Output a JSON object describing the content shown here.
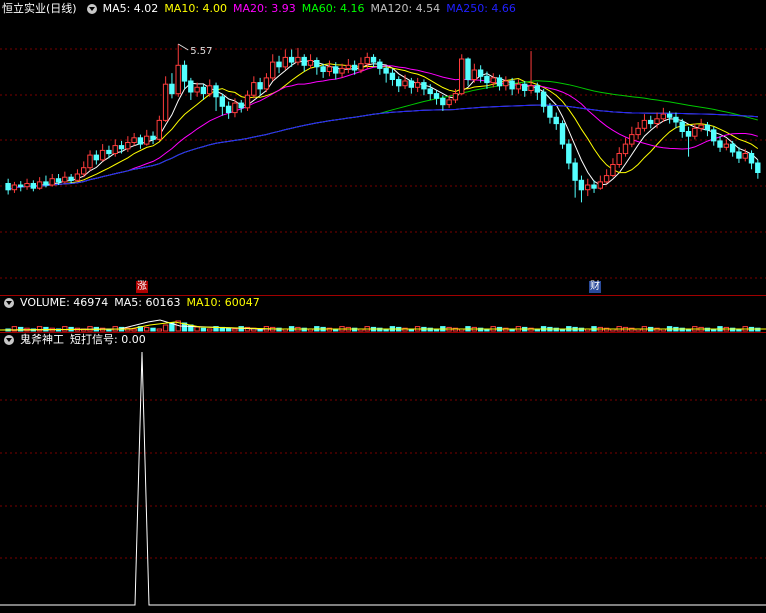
{
  "header": {
    "stock_name": "恒立实业(日线)",
    "ma": [
      {
        "label": "MA5: 4.02",
        "color": "#ffffff"
      },
      {
        "label": "MA10: 4.00",
        "color": "#ffff00"
      },
      {
        "label": "MA20: 3.93",
        "color": "#ff00ff"
      },
      {
        "label": "MA60: 4.16",
        "color": "#00ff00"
      },
      {
        "label": "MA120: 4.54",
        "color": "#c0c0c0"
      },
      {
        "label": "MA250: 4.66",
        "color": "#0000ff"
      }
    ]
  },
  "volume_header": {
    "volume": "VOLUME: 46974",
    "ma5": "MA5: 60163",
    "ma10": "MA10: 60047"
  },
  "indicator_header": {
    "name": "鬼斧神工",
    "signal": "短打信号: 0.00"
  },
  "markers": {
    "zhang": "涨",
    "cai": "财",
    "high_price": "5.57"
  },
  "colors": {
    "up": "#ff3c3c",
    "down": "#54ffff",
    "grid": "#7a0000",
    "ma5": "#ffffff",
    "ma10": "#ffff00",
    "ma20": "#ff00ff",
    "ma60": "#00c800",
    "ma120": "#c0c0c0",
    "ma250": "#2020ff"
  },
  "chart_data": [
    {
      "type": "candlestick",
      "title": "恒立实业(日线)",
      "ylim": [
        2.6,
        5.9
      ],
      "candles": [
        [
          3.8,
          3.72,
          3.86,
          3.66
        ],
        [
          3.72,
          3.78,
          3.82,
          3.68
        ],
        [
          3.78,
          3.76,
          3.83,
          3.7
        ],
        [
          3.76,
          3.8,
          3.86,
          3.72
        ],
        [
          3.8,
          3.74,
          3.84,
          3.7
        ],
        [
          3.74,
          3.82,
          3.88,
          3.72
        ],
        [
          3.82,
          3.78,
          3.9,
          3.75
        ],
        [
          3.78,
          3.86,
          3.92,
          3.76
        ],
        [
          3.86,
          3.82,
          3.92,
          3.78
        ],
        [
          3.82,
          3.88,
          3.95,
          3.8
        ],
        [
          3.88,
          3.84,
          3.92,
          3.8
        ],
        [
          3.84,
          3.92,
          3.98,
          3.82
        ],
        [
          3.92,
          4.0,
          4.08,
          3.88
        ],
        [
          4.0,
          4.16,
          4.22,
          3.96
        ],
        [
          4.16,
          4.1,
          4.22,
          4.04
        ],
        [
          4.1,
          4.22,
          4.3,
          4.08
        ],
        [
          4.22,
          4.18,
          4.28,
          4.12
        ],
        [
          4.18,
          4.28,
          4.36,
          4.14
        ],
        [
          4.28,
          4.24,
          4.34,
          4.18
        ],
        [
          4.24,
          4.32,
          4.4,
          4.2
        ],
        [
          4.32,
          4.38,
          4.44,
          4.28
        ],
        [
          4.38,
          4.3,
          4.42,
          4.24
        ],
        [
          4.3,
          4.4,
          4.48,
          4.28
        ],
        [
          4.4,
          4.36,
          4.46,
          4.3
        ],
        [
          4.36,
          4.6,
          4.66,
          4.34
        ],
        [
          4.6,
          5.06,
          5.16,
          4.58
        ],
        [
          5.06,
          4.94,
          5.2,
          4.88
        ],
        [
          4.94,
          5.3,
          5.57,
          4.9
        ],
        [
          5.3,
          5.1,
          5.36,
          5.0
        ],
        [
          5.1,
          4.96,
          5.14,
          4.86
        ],
        [
          4.96,
          5.02,
          5.08,
          4.9
        ],
        [
          5.02,
          4.94,
          5.06,
          4.86
        ],
        [
          4.94,
          5.04,
          5.12,
          4.9
        ],
        [
          5.04,
          4.9,
          5.08,
          4.72
        ],
        [
          4.9,
          4.78,
          4.94,
          4.66
        ],
        [
          4.78,
          4.7,
          4.84,
          4.62
        ],
        [
          4.7,
          4.82,
          4.88,
          4.64
        ],
        [
          4.82,
          4.76,
          4.86,
          4.7
        ],
        [
          4.76,
          4.92,
          4.98,
          4.72
        ],
        [
          4.92,
          5.08,
          5.16,
          4.88
        ],
        [
          5.08,
          5.0,
          5.14,
          4.92
        ],
        [
          5.0,
          5.14,
          5.2,
          4.96
        ],
        [
          5.14,
          5.34,
          5.44,
          5.1
        ],
        [
          5.34,
          5.28,
          5.42,
          5.2
        ],
        [
          5.28,
          5.4,
          5.5,
          5.24
        ],
        [
          5.4,
          5.34,
          5.5,
          5.28
        ],
        [
          5.34,
          5.4,
          5.52,
          5.3
        ],
        [
          5.4,
          5.3,
          5.44,
          5.22
        ],
        [
          5.3,
          5.36,
          5.44,
          5.26
        ],
        [
          5.36,
          5.28,
          5.4,
          5.18
        ],
        [
          5.28,
          5.22,
          5.32,
          5.14
        ],
        [
          5.22,
          5.28,
          5.36,
          5.16
        ],
        [
          5.28,
          5.2,
          5.34,
          5.12
        ],
        [
          5.2,
          5.26,
          5.32,
          5.14
        ],
        [
          5.26,
          5.3,
          5.38,
          5.2
        ],
        [
          5.3,
          5.24,
          5.36,
          5.18
        ],
        [
          5.24,
          5.32,
          5.4,
          5.2
        ],
        [
          5.32,
          5.4,
          5.46,
          5.26
        ],
        [
          5.4,
          5.34,
          5.44,
          5.28
        ],
        [
          5.34,
          5.26,
          5.38,
          5.18
        ],
        [
          5.26,
          5.2,
          5.3,
          5.08
        ],
        [
          5.2,
          5.12,
          5.26,
          5.04
        ],
        [
          5.12,
          5.04,
          5.16,
          4.96
        ],
        [
          5.04,
          5.1,
          5.18,
          5.0
        ],
        [
          5.1,
          5.02,
          5.14,
          4.94
        ],
        [
          5.02,
          5.08,
          5.14,
          4.96
        ],
        [
          5.08,
          5.0,
          5.12,
          4.92
        ],
        [
          5.0,
          4.94,
          5.06,
          4.86
        ],
        [
          4.94,
          4.88,
          4.98,
          4.8
        ],
        [
          4.88,
          4.8,
          4.92,
          4.72
        ],
        [
          4.8,
          4.86,
          4.92,
          4.76
        ],
        [
          4.86,
          4.94,
          5.0,
          4.82
        ],
        [
          4.94,
          5.38,
          5.44,
          4.92
        ],
        [
          5.38,
          5.12,
          5.4,
          5.04
        ],
        [
          5.12,
          5.24,
          5.32,
          5.08
        ],
        [
          5.24,
          5.16,
          5.3,
          5.08
        ],
        [
          5.16,
          5.08,
          5.22,
          5.0
        ],
        [
          5.08,
          5.14,
          5.2,
          5.02
        ],
        [
          5.14,
          5.04,
          5.18,
          4.98
        ],
        [
          5.04,
          5.1,
          5.16,
          4.98
        ],
        [
          5.1,
          5.0,
          5.14,
          4.92
        ],
        [
          5.0,
          5.06,
          5.12,
          4.94
        ],
        [
          5.06,
          4.98,
          5.1,
          4.9
        ],
        [
          4.98,
          5.04,
          5.48,
          4.94
        ],
        [
          5.04,
          4.96,
          5.08,
          4.86
        ],
        [
          4.96,
          4.78,
          5.0,
          4.7
        ],
        [
          4.78,
          4.64,
          4.82,
          4.56
        ],
        [
          4.64,
          4.56,
          4.7,
          4.48
        ],
        [
          4.56,
          4.3,
          4.6,
          4.24
        ],
        [
          4.3,
          4.06,
          4.36,
          3.98
        ],
        [
          4.06,
          3.84,
          4.12,
          3.62
        ],
        [
          3.84,
          3.72,
          3.9,
          3.56
        ],
        [
          3.72,
          3.78,
          3.86,
          3.64
        ],
        [
          3.78,
          3.74,
          3.84,
          3.68
        ],
        [
          3.74,
          3.82,
          3.9,
          3.72
        ],
        [
          3.82,
          3.9,
          3.98,
          3.8
        ],
        [
          3.9,
          4.04,
          4.12,
          3.88
        ],
        [
          4.04,
          4.18,
          4.26,
          4.0
        ],
        [
          4.18,
          4.3,
          4.38,
          4.14
        ],
        [
          4.3,
          4.42,
          4.52,
          4.26
        ],
        [
          4.42,
          4.5,
          4.58,
          4.36
        ],
        [
          4.5,
          4.6,
          4.68,
          4.46
        ],
        [
          4.6,
          4.56,
          4.66,
          4.5
        ],
        [
          4.56,
          4.62,
          4.7,
          4.5
        ],
        [
          4.62,
          4.68,
          4.76,
          4.58
        ],
        [
          4.68,
          4.64,
          4.72,
          4.56
        ],
        [
          4.64,
          4.58,
          4.7,
          4.5
        ],
        [
          4.58,
          4.46,
          4.62,
          4.38
        ],
        [
          4.46,
          4.4,
          4.52,
          4.14
        ],
        [
          4.4,
          4.5,
          4.56,
          4.36
        ],
        [
          4.5,
          4.54,
          4.62,
          4.46
        ],
        [
          4.54,
          4.48,
          4.58,
          4.4
        ],
        [
          4.48,
          4.34,
          4.52,
          4.28
        ],
        [
          4.34,
          4.26,
          4.4,
          4.2
        ],
        [
          4.26,
          4.3,
          4.36,
          4.22
        ],
        [
          4.3,
          4.2,
          4.34,
          4.14
        ],
        [
          4.2,
          4.12,
          4.26,
          4.06
        ],
        [
          4.12,
          4.18,
          4.24,
          4.08
        ],
        [
          4.18,
          4.06,
          4.22,
          3.98
        ],
        [
          4.06,
          3.94,
          4.1,
          3.86
        ]
      ],
      "annotations": [
        "5.57"
      ]
    },
    {
      "type": "bar",
      "title": "VOLUME",
      "series_names": [
        "VOLUME",
        "MA5",
        "MA10"
      ],
      "latest": {
        "VOLUME": 46974,
        "MA5": 60163,
        "MA10": 60047
      },
      "ylim": [
        0,
        600000
      ]
    },
    {
      "type": "line",
      "title": "鬼斧神工",
      "series_names": [
        "短打信号"
      ],
      "latest": 0.0,
      "ylim": [
        0,
        1
      ]
    }
  ]
}
